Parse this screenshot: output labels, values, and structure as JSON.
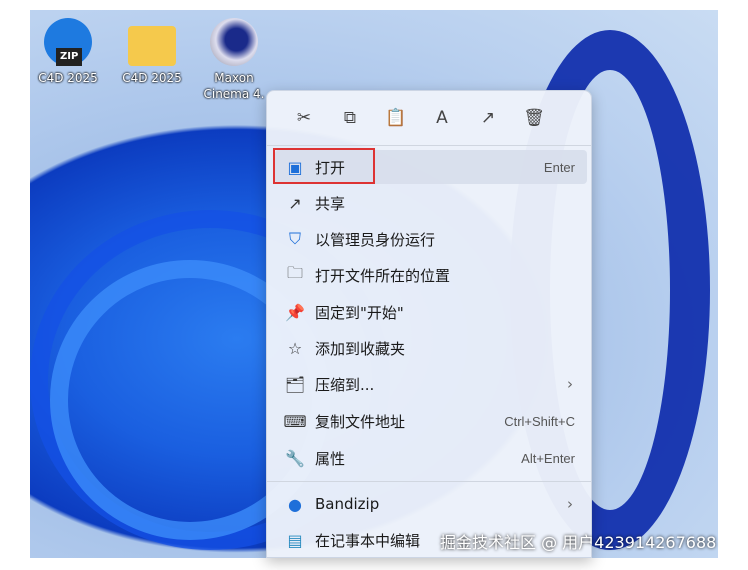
{
  "desktop": {
    "icons": [
      {
        "label": "C4D 2025",
        "icon": "bandizip-zip-icon"
      },
      {
        "label": "C4D 2025",
        "icon": "folder-icon"
      },
      {
        "label": "Maxon Cinema 4.",
        "icon": "cinema4d-shortcut-icon"
      }
    ]
  },
  "menu": {
    "toolbar": [
      {
        "icon": "cut-icon",
        "glyph": "✂"
      },
      {
        "icon": "copy-icon",
        "glyph": "⧉"
      },
      {
        "icon": "paste-icon",
        "glyph": "📋"
      },
      {
        "icon": "rename-icon",
        "glyph": "A"
      },
      {
        "icon": "share-icon",
        "glyph": "↗"
      },
      {
        "icon": "delete-icon",
        "glyph": "🗑"
      }
    ],
    "items": [
      {
        "label": "打开",
        "shortcut": "Enter",
        "icon": "open-app-icon",
        "glyph": "▣"
      },
      {
        "label": "共享",
        "shortcut": "",
        "icon": "share-icon",
        "glyph": "↗"
      },
      {
        "label": "以管理员身份运行",
        "shortcut": "",
        "icon": "shield-icon",
        "glyph": "⛉"
      },
      {
        "label": "打开文件所在的位置",
        "shortcut": "",
        "icon": "folder-icon",
        "glyph": "🗀"
      },
      {
        "label": "固定到\"开始\"",
        "shortcut": "",
        "icon": "pin-icon",
        "glyph": "📌"
      },
      {
        "label": "添加到收藏夹",
        "shortcut": "",
        "icon": "star-icon",
        "glyph": "☆"
      },
      {
        "label": "压缩到...",
        "shortcut": "",
        "icon": "zip-folder-icon",
        "glyph": "🗂",
        "arrow": "›"
      },
      {
        "label": "复制文件地址",
        "shortcut": "Ctrl+Shift+C",
        "icon": "copy-path-icon",
        "glyph": "⌨"
      },
      {
        "label": "属性",
        "shortcut": "Alt+Enter",
        "icon": "wrench-icon",
        "glyph": "🔧"
      },
      {
        "label": "Bandizip",
        "shortcut": "",
        "icon": "bandizip-icon",
        "glyph": "●",
        "arrow": "›"
      },
      {
        "label": "在记事本中编辑",
        "shortcut": "",
        "icon": "notepad-icon",
        "glyph": "▤"
      }
    ]
  },
  "watermark": "掘金技术社区 @ 用户423914267688"
}
